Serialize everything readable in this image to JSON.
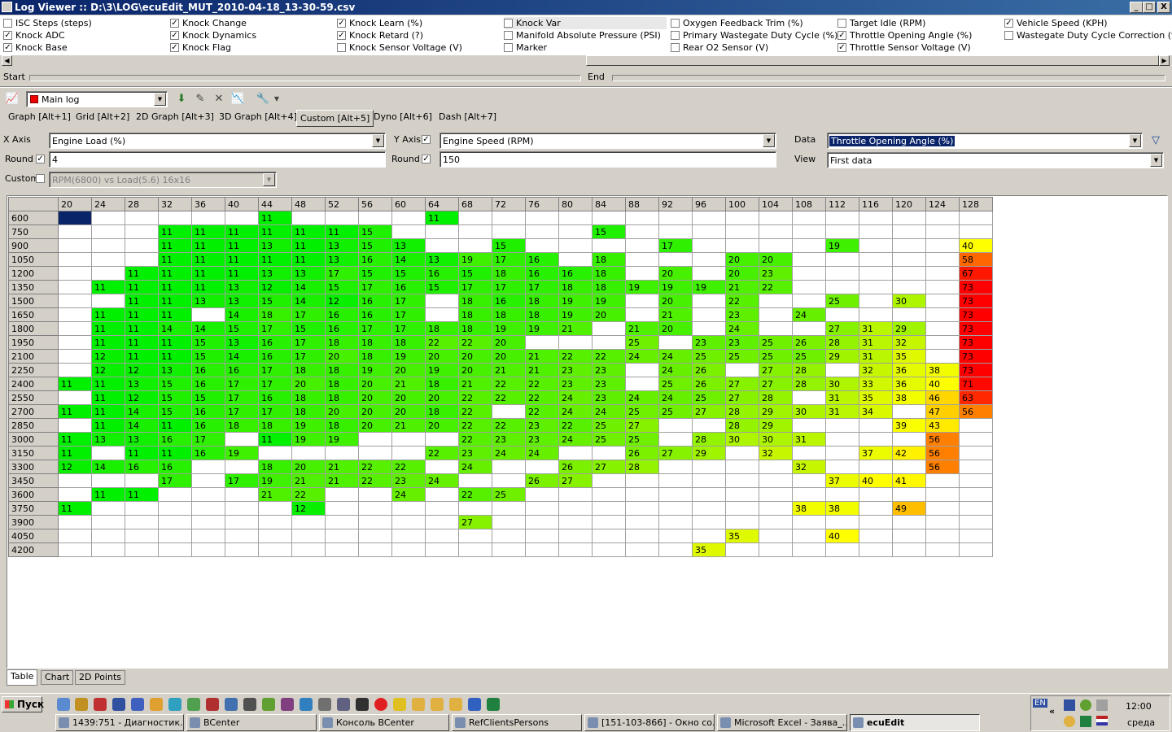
{
  "window": {
    "title": "Log Viewer :: D:\\3\\LOG\\ecuEdit_MUT_2010-04-18_13-30-59.csv",
    "min": "_",
    "max": "□",
    "close": "X"
  },
  "channels": [
    {
      "label": "ISC Steps (steps)",
      "checked": false
    },
    {
      "label": "Knock ADC",
      "checked": true
    },
    {
      "label": "Knock Base",
      "checked": true
    },
    {
      "label": "Knock Change",
      "checked": true
    },
    {
      "label": "Knock Dynamics",
      "checked": true
    },
    {
      "label": "Knock Flag",
      "checked": true
    },
    {
      "label": "Knock Learn (%)",
      "checked": true
    },
    {
      "label": "Knock Retard (?)",
      "checked": true
    },
    {
      "label": "Knock Sensor Voltage (V)",
      "checked": false
    },
    {
      "label": "Knock Var",
      "checked": false
    },
    {
      "label": "Manifold Absolute Pressure (PSI)",
      "checked": false
    },
    {
      "label": "Marker",
      "checked": false
    },
    {
      "label": "Oxygen Feedback Trim (%)",
      "checked": false
    },
    {
      "label": "Primary Wastegate Duty Cycle (%)",
      "checked": false
    },
    {
      "label": "Rear O2 Sensor (V)",
      "checked": false
    },
    {
      "label": "Target Idle (RPM)",
      "checked": false
    },
    {
      "label": "Throttle Opening Angle (%)",
      "checked": true
    },
    {
      "label": "Throttle Sensor Voltage (V)",
      "checked": true
    },
    {
      "label": "Vehicle Speed (KPH)",
      "checked": true
    },
    {
      "label": "Wastegate Duty Cycle Correction (%)",
      "checked": false
    }
  ],
  "range": {
    "start_label": "Start",
    "end_label": "End"
  },
  "toolbar": {
    "log_select": "Main log"
  },
  "tabs": [
    "Graph [Alt+1]",
    "Grid [Alt+2]",
    "2D Graph [Alt+3]",
    "3D Graph [Alt+4]",
    "Custom [Alt+5]",
    "Dyno [Alt+6]",
    "Dash [Alt+7]"
  ],
  "active_tab": 4,
  "axes": {
    "x_label": "X Axis",
    "x_value": "Engine Load (%)",
    "y_label": "Y Axis",
    "y_value": "Engine Speed (RPM)",
    "round_label": "Round",
    "x_round": "4",
    "y_round": "150",
    "custom_label": "Custom",
    "custom_value": "RPM(6800) vs Load(5.6) 16x16",
    "data_label": "Data",
    "data_value": "Throttle Opening Angle (%)",
    "view_label": "View",
    "view_value": "First data"
  },
  "table": {
    "cols": [
      20,
      24,
      28,
      32,
      36,
      40,
      44,
      48,
      52,
      56,
      60,
      64,
      68,
      72,
      76,
      80,
      84,
      88,
      92,
      96,
      100,
      104,
      108,
      112,
      116,
      120,
      124,
      128
    ],
    "rows": [
      {
        "rpm": 600,
        "cells": {
          "44": 11,
          "64": 11
        }
      },
      {
        "rpm": 750,
        "cells": {
          "32": 11,
          "36": 11,
          "40": 11,
          "44": 11,
          "48": 11,
          "52": 11,
          "56": 15,
          "84": 15
        }
      },
      {
        "rpm": 900,
        "cells": {
          "32": 11,
          "36": 11,
          "40": 11,
          "44": 13,
          "48": 11,
          "52": 13,
          "56": 15,
          "60": 13,
          "72": 15,
          "92": 17,
          "112": 19,
          "128": 40
        }
      },
      {
        "rpm": 1050,
        "cells": {
          "32": 11,
          "36": 11,
          "40": 11,
          "44": 11,
          "48": 11,
          "52": 13,
          "56": 16,
          "60": 14,
          "64": 13,
          "68": 19,
          "72": 17,
          "76": 16,
          "84": 18,
          "100": 20,
          "104": 20,
          "128": 58
        }
      },
      {
        "rpm": 1200,
        "cells": {
          "28": 11,
          "32": 11,
          "36": 11,
          "40": 11,
          "44": 13,
          "48": 13,
          "52": 17,
          "56": 15,
          "60": 15,
          "64": 16,
          "68": 15,
          "72": 18,
          "76": 16,
          "80": 16,
          "84": 18,
          "92": 20,
          "100": 20,
          "104": 23,
          "128": 67
        }
      },
      {
        "rpm": 1350,
        "cells": {
          "24": 11,
          "28": 11,
          "32": 11,
          "36": 11,
          "40": 13,
          "44": 12,
          "48": 14,
          "52": 15,
          "56": 17,
          "60": 16,
          "64": 15,
          "68": 17,
          "72": 17,
          "76": 17,
          "80": 18,
          "84": 18,
          "88": 19,
          "92": 19,
          "96": 19,
          "100": 21,
          "104": 22,
          "128": 73
        }
      },
      {
        "rpm": 1500,
        "cells": {
          "28": 11,
          "32": 11,
          "36": 13,
          "40": 13,
          "44": 15,
          "48": 14,
          "52": 12,
          "56": 16,
          "60": 17,
          "68": 18,
          "72": 16,
          "76": 18,
          "80": 19,
          "84": 19,
          "92": 20,
          "100": 22,
          "112": 25,
          "120": 30,
          "128": 73
        }
      },
      {
        "rpm": 1650,
        "cells": {
          "24": 11,
          "28": 11,
          "32": 11,
          "40": 14,
          "44": 18,
          "48": 17,
          "52": 16,
          "56": 16,
          "60": 17,
          "68": 18,
          "72": 18,
          "76": 18,
          "80": 19,
          "84": 20,
          "92": 21,
          "100": 23,
          "108": 24,
          "128": 73
        }
      },
      {
        "rpm": 1800,
        "cells": {
          "24": 11,
          "28": 11,
          "32": 14,
          "36": 14,
          "40": 15,
          "44": 17,
          "48": 15,
          "52": 16,
          "56": 17,
          "60": 17,
          "64": 18,
          "68": 18,
          "72": 19,
          "76": 19,
          "80": 21,
          "88": 21,
          "92": 20,
          "100": 24,
          "112": 27,
          "116": 31,
          "120": 29,
          "128": 73
        }
      },
      {
        "rpm": 1950,
        "cells": {
          "24": 11,
          "28": 11,
          "32": 11,
          "36": 15,
          "40": 13,
          "44": 16,
          "48": 17,
          "52": 18,
          "56": 18,
          "60": 18,
          "64": 22,
          "68": 22,
          "72": 20,
          "88": 25,
          "96": 23,
          "100": 23,
          "104": 25,
          "108": 26,
          "112": 28,
          "116": 31,
          "120": 32,
          "128": 73
        }
      },
      {
        "rpm": 2100,
        "cells": {
          "24": 12,
          "28": 11,
          "32": 11,
          "36": 15,
          "40": 14,
          "44": 16,
          "48": 17,
          "52": 20,
          "56": 18,
          "60": 19,
          "64": 20,
          "68": 20,
          "72": 20,
          "76": 21,
          "80": 22,
          "84": 22,
          "88": 24,
          "92": 24,
          "96": 25,
          "100": 25,
          "104": 25,
          "108": 25,
          "112": 29,
          "116": 31,
          "120": 35,
          "128": 73
        }
      },
      {
        "rpm": 2250,
        "cells": {
          "24": 12,
          "28": 12,
          "32": 13,
          "36": 16,
          "40": 16,
          "44": 17,
          "48": 18,
          "52": 18,
          "56": 19,
          "60": 20,
          "64": 19,
          "68": 20,
          "72": 21,
          "76": 21,
          "80": 23,
          "84": 23,
          "92": 24,
          "96": 26,
          "104": 27,
          "108": 28,
          "116": 32,
          "120": 36,
          "124": 38,
          "128": 73
        }
      },
      {
        "rpm": 2400,
        "cells": {
          "20": 11,
          "24": 11,
          "28": 13,
          "32": 15,
          "36": 16,
          "40": 17,
          "44": 17,
          "48": 20,
          "52": 18,
          "56": 20,
          "60": 21,
          "64": 18,
          "68": 21,
          "72": 22,
          "76": 22,
          "80": 23,
          "84": 23,
          "92": 25,
          "96": 26,
          "100": 27,
          "104": 27,
          "108": 28,
          "112": 30,
          "116": 33,
          "120": 36,
          "124": 40,
          "128": 71
        }
      },
      {
        "rpm": 2550,
        "cells": {
          "24": 11,
          "28": 12,
          "32": 15,
          "36": 15,
          "40": 17,
          "44": 16,
          "48": 18,
          "52": 18,
          "56": 20,
          "60": 20,
          "64": 20,
          "68": 22,
          "72": 22,
          "76": 22,
          "80": 24,
          "84": 23,
          "88": 24,
          "92": 24,
          "96": 25,
          "100": 27,
          "104": 28,
          "112": 31,
          "116": 35,
          "120": 38,
          "124": 46,
          "128": 63
        }
      },
      {
        "rpm": 2700,
        "cells": {
          "20": 11,
          "24": 11,
          "28": 14,
          "32": 15,
          "36": 16,
          "40": 17,
          "44": 17,
          "48": 18,
          "52": 20,
          "56": 20,
          "60": 20,
          "64": 18,
          "68": 22,
          "76": 22,
          "80": 24,
          "84": 24,
          "88": 25,
          "92": 25,
          "96": 27,
          "100": 28,
          "104": 29,
          "108": 30,
          "112": 31,
          "116": 34,
          "124": 47,
          "128": 56
        }
      },
      {
        "rpm": 2850,
        "cells": {
          "24": 11,
          "28": 14,
          "32": 11,
          "36": 16,
          "40": 18,
          "44": 18,
          "48": 19,
          "52": 18,
          "56": 20,
          "60": 21,
          "64": 20,
          "68": 22,
          "72": 22,
          "76": 23,
          "80": 22,
          "84": 25,
          "88": 27,
          "100": 28,
          "104": 29,
          "120": 39,
          "124": 43
        }
      },
      {
        "rpm": 3000,
        "cells": {
          "20": 11,
          "24": 13,
          "28": 13,
          "32": 16,
          "36": 17,
          "44": 11,
          "48": 19,
          "52": 19,
          "68": 22,
          "72": 23,
          "76": 23,
          "80": 24,
          "84": 25,
          "88": 25,
          "96": 28,
          "100": 30,
          "104": 30,
          "108": 31,
          "124": 56
        }
      },
      {
        "rpm": 3150,
        "cells": {
          "20": 11,
          "28": 11,
          "32": 11,
          "36": 16,
          "40": 19,
          "64": 22,
          "68": 23,
          "72": 24,
          "76": 24,
          "88": 26,
          "92": 27,
          "96": 29,
          "104": 32,
          "116": 37,
          "120": 42,
          "124": 56
        }
      },
      {
        "rpm": 3300,
        "cells": {
          "20": 12,
          "24": 14,
          "28": 16,
          "32": 16,
          "44": 18,
          "48": 20,
          "52": 21,
          "56": 22,
          "60": 22,
          "68": 24,
          "80": 26,
          "84": 27,
          "88": 28,
          "108": 32,
          "124": 56
        }
      },
      {
        "rpm": 3450,
        "cells": {
          "32": 17,
          "40": 17,
          "44": 19,
          "48": 21,
          "52": 21,
          "56": 22,
          "60": 23,
          "64": 24,
          "76": 26,
          "80": 27,
          "112": 37,
          "116": 40,
          "120": 41
        }
      },
      {
        "rpm": 3600,
        "cells": {
          "24": 11,
          "28": 11,
          "44": 21,
          "48": 22,
          "60": 24,
          "68": 22,
          "72": 25
        }
      },
      {
        "rpm": 3750,
        "cells": {
          "20": 11,
          "48": 12,
          "108": 38,
          "112": 38,
          "120": 49
        }
      },
      {
        "rpm": 3900,
        "cells": {
          "68": 27
        }
      },
      {
        "rpm": 4050,
        "cells": {
          "100": 35,
          "112": 40
        }
      },
      {
        "rpm": 4200,
        "cells": {
          "96": 35
        }
      }
    ]
  },
  "bottom_tabs": [
    "Table",
    "Chart",
    "2D Points"
  ],
  "taskbar": {
    "start": "Пуск",
    "tasks": [
      "1439:751 - Диагностик...",
      "BCenter",
      "Консоль BCenter",
      "RefClientsPersons",
      "[151-103-866] - Окно со...",
      "Microsoft Excel - Заява_...",
      "ecuEdit"
    ],
    "active_task": 6,
    "lang": "EN",
    "time": "12:00",
    "day": "среда"
  }
}
